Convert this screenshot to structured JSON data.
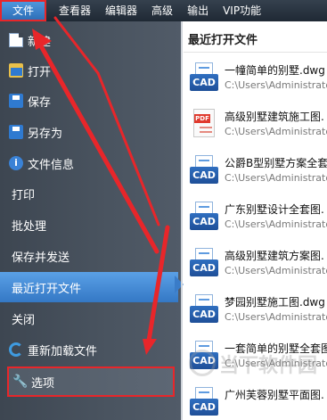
{
  "menubar": {
    "items": [
      {
        "label": "文件"
      },
      {
        "label": "查看器"
      },
      {
        "label": "编辑器"
      },
      {
        "label": "高级"
      },
      {
        "label": "输出"
      },
      {
        "label": "VIP功能"
      }
    ]
  },
  "sidebar": {
    "items": [
      {
        "label": "新建",
        "icon": "new-file-icon"
      },
      {
        "label": "打开",
        "icon": "open-folder-icon"
      },
      {
        "label": "保存",
        "icon": "save-disk-icon"
      },
      {
        "label": "另存为",
        "icon": "save-as-disk-icon"
      },
      {
        "label": "文件信息",
        "icon": "info-icon"
      },
      {
        "label": "打印"
      },
      {
        "label": "批处理"
      },
      {
        "label": "保存并发送"
      },
      {
        "label": "最近打开文件"
      },
      {
        "label": "关闭"
      },
      {
        "label": "重新加载文件",
        "icon": "reload-icon"
      },
      {
        "label": "选项",
        "icon": "wrench-icon"
      }
    ]
  },
  "recent": {
    "title": "最近打开文件",
    "files": [
      {
        "name": "一幢简单的别墅.dwg",
        "path": "C:\\Users\\Administrator\\",
        "icon": "cad-file-icon"
      },
      {
        "name": "高级别墅建筑施工图.",
        "path": "C:\\Users\\Administrator\\",
        "icon": "pdf-file-icon"
      },
      {
        "name": "公爵B型别墅方案全套图",
        "path": "C:\\Users\\Administrator\\",
        "icon": "cad-file-icon"
      },
      {
        "name": "广东别墅设计全套图.",
        "path": "C:\\Users\\Administrator\\",
        "icon": "cad-file-icon"
      },
      {
        "name": "高级别墅建筑方案图.",
        "path": "C:\\Users\\Administrator\\",
        "icon": "cad-file-icon"
      },
      {
        "name": "梦园别墅施工图.dwg",
        "path": "C:\\Users\\Administrator\\",
        "icon": "cad-file-icon"
      },
      {
        "name": "一套简单的别墅全套图",
        "path": "C:\\Users\\Administrator\\",
        "icon": "cad-file-icon"
      },
      {
        "name": "广州芙蓉别墅平面图.",
        "path": "",
        "icon": "cad-file-icon"
      }
    ],
    "cad_label": "CAD",
    "pdf_label": "PDF"
  },
  "watermark": "当下软件园",
  "colors": {
    "menubar": "#1f2934",
    "sidebar": "#4a5460",
    "selected": "#3478c5",
    "annotation": "#e8262a"
  }
}
